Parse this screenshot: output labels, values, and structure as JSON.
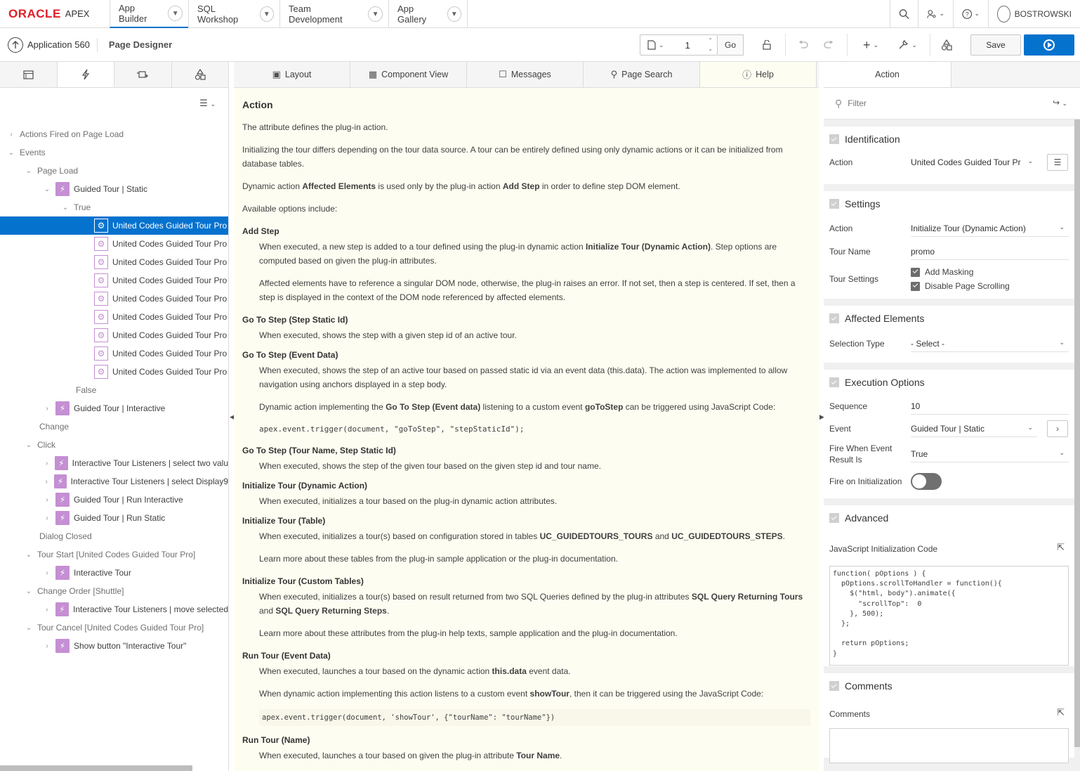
{
  "brand": {
    "oracle": "ORACLE",
    "apex": "APEX"
  },
  "nav_tabs": [
    {
      "label": "App Builder"
    },
    {
      "label": "SQL Workshop"
    },
    {
      "label": "Team Development"
    },
    {
      "label": "App Gallery"
    }
  ],
  "user": {
    "name": "BOSTROWSKI"
  },
  "toolbar": {
    "application": "Application 560",
    "page_designer": "Page Designer",
    "page_number": "1",
    "go_label": "Go",
    "save_label": "Save"
  },
  "tree": {
    "nodes": [
      {
        "label": "Actions Fired on Page Load"
      },
      {
        "label": "Events"
      },
      {
        "label": "Page Load"
      },
      {
        "label": "Guided Tour | Static"
      },
      {
        "label": "True"
      },
      {
        "label": "United Codes Guided Tour Pro"
      },
      {
        "label": "United Codes Guided Tour Pro"
      },
      {
        "label": "United Codes Guided Tour Pro"
      },
      {
        "label": "United Codes Guided Tour Pro"
      },
      {
        "label": "United Codes Guided Tour Pro"
      },
      {
        "label": "United Codes Guided Tour Pro"
      },
      {
        "label": "United Codes Guided Tour Pro"
      },
      {
        "label": "United Codes Guided Tour Pro"
      },
      {
        "label": "United Codes Guided Tour Pro"
      },
      {
        "label": "False"
      },
      {
        "label": "Guided Tour | Interactive"
      },
      {
        "label": "Change"
      },
      {
        "label": "Click"
      },
      {
        "label": "Interactive Tour Listeners | select two valu"
      },
      {
        "label": "Interactive Tour Listeners | select Display9"
      },
      {
        "label": "Guided Tour | Run Interactive"
      },
      {
        "label": "Guided Tour | Run Static"
      },
      {
        "label": "Dialog Closed"
      },
      {
        "label": "Tour Start [United Codes Guided Tour Pro]"
      },
      {
        "label": "Interactive Tour"
      },
      {
        "label": "Change Order [Shuttle]"
      },
      {
        "label": "Interactive Tour Listeners | move selected"
      },
      {
        "label": "Tour Cancel [United Codes Guided Tour Pro]"
      },
      {
        "label": "Show button \"Interactive Tour\""
      }
    ]
  },
  "center_tabs": [
    {
      "label": "Layout"
    },
    {
      "label": "Component View"
    },
    {
      "label": "Messages"
    },
    {
      "label": "Page Search"
    },
    {
      "label": "Help"
    }
  ],
  "help": {
    "title": "Action",
    "p1": "The attribute defines the plug-in action.",
    "p2": "Initializing the tour differs depending on the tour data source. A tour can be entirely defined using only dynamic actions or it can be initialized from database tables.",
    "p3a": "Dynamic action ",
    "p3b": "Affected Elements",
    "p3c": " is used only by the plug-in action ",
    "p3d": "Add Step",
    "p3e": " in order to define step DOM element.",
    "p4": "Available options include:",
    "addstep_t": "Add Step",
    "addstep_1a": "When executed, a new step is added to a tour defined using the plug-in dynamic action ",
    "addstep_1b": "Initialize Tour (Dynamic Action)",
    "addstep_1c": ". Step options are computed based on given the plug-in attributes.",
    "addstep_2": "Affected elements have to reference a singular DOM node, otherwise, the plug-in raises an error. If not set, then a step is centered. If set, then a step is displayed in the context of the DOM node referenced by affected elements.",
    "goto_static_t": "Go To Step (Step Static Id)",
    "goto_static_d": "When executed, shows the step with a given step id of an active tour.",
    "goto_event_t": "Go To Step (Event Data)",
    "goto_event_d": "When executed, shows the step of an active tour based on passed static id via an event data (this.data). The action was implemented to allow navigation using anchors displayed in a step body.",
    "goto_event_2a": "Dynamic action implementing the ",
    "goto_event_2b": "Go To Step (Event data)",
    "goto_event_2c": " listening to a custom event ",
    "goto_event_2d": "goToStep",
    "goto_event_2e": " can be triggered using JavaScript Code:",
    "goto_event_code": "apex.event.trigger(document, \"goToStep\", \"stepStaticId\");",
    "goto_name_t": "Go To Step (Tour Name, Step Static Id)",
    "goto_name_d": "When executed, shows the step of the given tour based on the given step id and tour name.",
    "init_da_t": "Initialize Tour (Dynamic Action)",
    "init_da_d": "When executed, initializes a tour based on the plug-in dynamic action attributes.",
    "init_table_t": "Initialize Tour (Table)",
    "init_table_da": "When executed, initializes a tour(s) based on configuration stored in tables ",
    "init_table_db": "UC_GUIDEDTOURS_TOURS",
    "init_table_dc": " and ",
    "init_table_dd": "UC_GUIDEDTOURS_STEPS",
    "init_table_de": ".",
    "init_table_2": "Learn more about these tables from the plug-in sample application or the plug-in documentation.",
    "init_custom_t": "Initialize Tour (Custom Tables)",
    "init_custom_da": "When executed, initializes a tour(s) based on result returned from two SQL Queries defined by the plug-in attributes ",
    "init_custom_db": "SQL Query Returning Tours",
    "init_custom_dc": " and ",
    "init_custom_dd": "SQL Query Returning Steps",
    "init_custom_de": ".",
    "init_custom_2": "Learn more about these attributes from the plug-in help texts, sample application and the plug-in documentation.",
    "run_event_t": "Run Tour (Event Data)",
    "run_event_da": "When executed, launches a tour based on the dynamic action ",
    "run_event_db": "this.data",
    "run_event_dc": " event data.",
    "run_event_2a": "When dynamic action implementing this action listens to a custom event ",
    "run_event_2b": "showTour",
    "run_event_2c": ", then it can be triggered using the JavaScript Code:",
    "run_event_code": "apex.event.trigger(document, 'showTour', {\"tourName\": \"tourName\"})",
    "run_name_t": "Run Tour (Name)",
    "run_name_da": "When executed, launches a tour based on given the plug-in attribute ",
    "run_name_db": "Tour Name",
    "run_name_dc": "."
  },
  "props": {
    "tab": "Action",
    "filter_placeholder": "Filter",
    "identification": {
      "title": "Identification",
      "action_label": "Action",
      "action_value": "United Codes Guided Tour Pr"
    },
    "settings": {
      "title": "Settings",
      "action_label": "Action",
      "action_value": "Initialize Tour (Dynamic Action)",
      "tour_name_label": "Tour Name",
      "tour_name_value": "promo",
      "tour_settings_label": "Tour Settings",
      "opt1": "Add Masking",
      "opt2": "Disable Page Scrolling"
    },
    "affected": {
      "title": "Affected Elements",
      "selection_label": "Selection Type",
      "selection_value": "- Select -"
    },
    "execution": {
      "title": "Execution Options",
      "sequence_label": "Sequence",
      "sequence_value": "10",
      "event_label": "Event",
      "event_value": "Guided Tour | Static",
      "fire_label": "Fire When Event Result Is",
      "fire_value": "True",
      "fire_init_label": "Fire on Initialization"
    },
    "advanced": {
      "title": "Advanced",
      "js_label": "JavaScript Initialization Code",
      "js_code": "function( pOptions ) {\n  pOptions.scrollToHandler = function(){\n    $(\"html, body\").animate({\n      \"scrollTop\":  0\n    }, 500);\n  };\n\n  return pOptions;\n}"
    },
    "comments": {
      "title": "Comments",
      "label": "Comments"
    }
  }
}
